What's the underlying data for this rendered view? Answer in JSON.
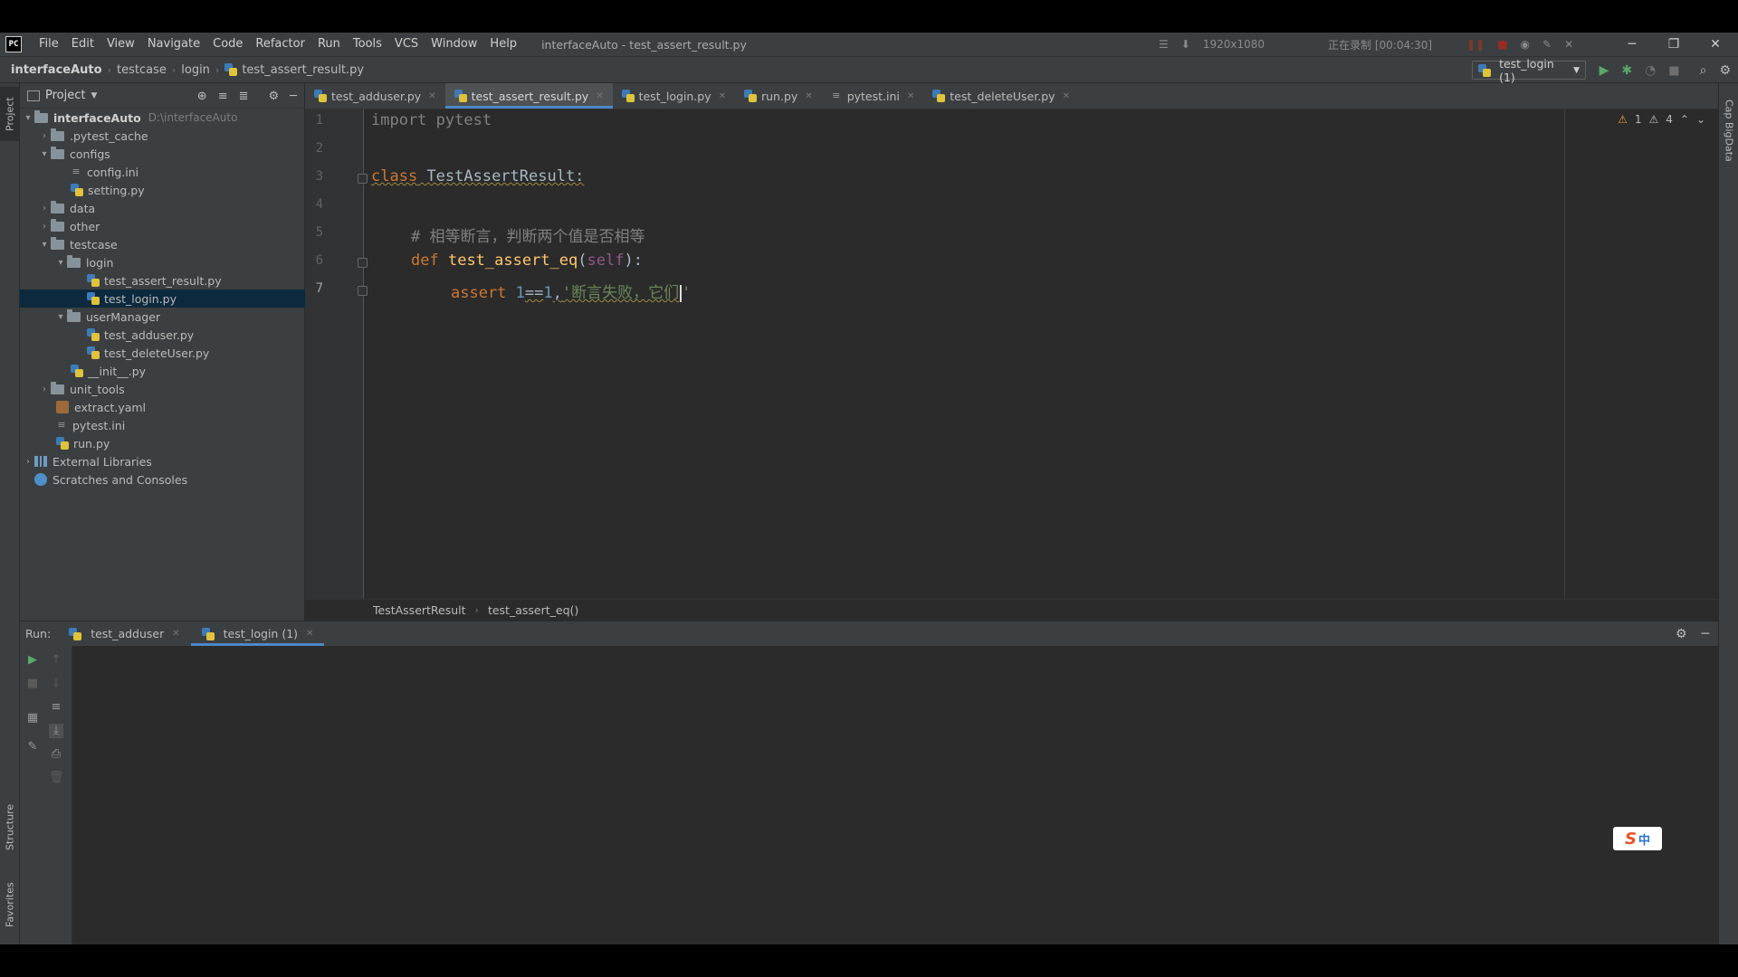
{
  "titlebar": {
    "menu": [
      "File",
      "Edit",
      "View",
      "Navigate",
      "Code",
      "Refactor",
      "Run",
      "Tools",
      "VCS",
      "Window",
      "Help"
    ],
    "title": "interfaceAuto - test_assert_result.py",
    "resolution": "1920x1080",
    "recording": "正在录制 [00:04:30]"
  },
  "navbar": {
    "crumbs": [
      "interfaceAuto",
      "testcase",
      "login",
      "test_assert_result.py"
    ],
    "run_config": "test_login (1)"
  },
  "project": {
    "title": "Project",
    "tree": [
      {
        "label": "interfaceAuto",
        "path": "D:\\interfaceAuto"
      },
      {
        "label": ".pytest_cache"
      },
      {
        "label": "configs"
      },
      {
        "label": "config.ini"
      },
      {
        "label": "setting.py"
      },
      {
        "label": "data"
      },
      {
        "label": "other"
      },
      {
        "label": "testcase"
      },
      {
        "label": "login"
      },
      {
        "label": "test_assert_result.py"
      },
      {
        "label": "test_login.py"
      },
      {
        "label": "userManager"
      },
      {
        "label": "test_adduser.py"
      },
      {
        "label": "test_deleteUser.py"
      },
      {
        "label": "__init__.py"
      },
      {
        "label": "unit_tools"
      },
      {
        "label": "extract.yaml"
      },
      {
        "label": "pytest.ini"
      },
      {
        "label": "run.py"
      },
      {
        "label": "External Libraries"
      },
      {
        "label": "Scratches and Consoles"
      }
    ]
  },
  "tabs": [
    "test_adduser.py",
    "test_assert_result.py",
    "test_login.py",
    "run.py",
    "pytest.ini",
    "test_deleteUser.py"
  ],
  "editor": {
    "line_numbers": [
      "1",
      "2",
      "3",
      "4",
      "5",
      "6",
      "7"
    ],
    "line1": {
      "kw": "import",
      "mod": " pytest"
    },
    "line3": {
      "kw": "class",
      "name": " TestAssertResult:"
    },
    "line5": {
      "comment": "# 相等断言，判断两个值是否相等"
    },
    "line6": {
      "kw": "def",
      "fn": "test_assert_eq",
      "open": "(",
      "self": "self",
      "close": "):"
    },
    "line7": {
      "kw": "assert",
      "n1": "1",
      "op": "==",
      "n2": "1",
      "comma": ",",
      "str": "'断言失败，它们",
      "str_end": "'"
    },
    "inspections": {
      "warnings": "1",
      "weak_warnings": "4"
    },
    "breadcrumb": [
      "TestAssertResult",
      "test_assert_eq()"
    ]
  },
  "run_panel": {
    "label": "Run:",
    "tabs": [
      "test_adduser",
      "test_login (1)"
    ]
  },
  "side_tabs": {
    "project": "Project",
    "structure": "Structure",
    "favorites": "Favorites",
    "right": "Cap BigData"
  },
  "ime": {
    "logo": "S",
    "mode": "中"
  }
}
